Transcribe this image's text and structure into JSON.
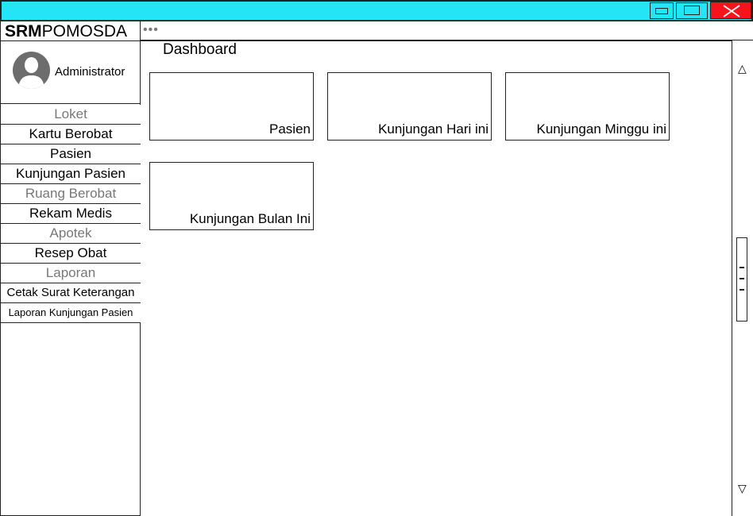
{
  "window": {
    "buttons": {
      "minimize_icon": "minimize-icon",
      "maximize_icon": "maximize-icon",
      "close_icon": "close-icon"
    }
  },
  "brand": {
    "bold": "SRM",
    "rest": "POMOSDA"
  },
  "toolbar": {
    "more": "•••"
  },
  "user": {
    "name": "Administrator",
    "avatar_icon": "user-avatar-icon"
  },
  "sidebar": {
    "items": [
      {
        "label": "Loket",
        "type": "header"
      },
      {
        "label": "Kartu Berobat",
        "type": "link"
      },
      {
        "label": "Pasien",
        "type": "link"
      },
      {
        "label": "Kunjungan Pasien",
        "type": "link"
      },
      {
        "label": "Ruang Berobat",
        "type": "header"
      },
      {
        "label": "Rekam Medis",
        "type": "link"
      },
      {
        "label": "Apotek",
        "type": "header"
      },
      {
        "label": "Resep Obat",
        "type": "link"
      },
      {
        "label": "Laporan",
        "type": "header"
      },
      {
        "label": "Cetak Surat Keterangan",
        "type": "link"
      },
      {
        "label": "Laporan Kunjungan Pasien",
        "type": "link"
      }
    ]
  },
  "main": {
    "title": "Dashboard",
    "cards": [
      {
        "label": "Pasien"
      },
      {
        "label": "Kunjungan Hari ini"
      },
      {
        "label": "Kunjungan Minggu ini"
      },
      {
        "label": "Kunjungan Bulan Ini"
      }
    ]
  },
  "scrollbar": {
    "up": "△",
    "down": "▽"
  },
  "colors": {
    "titlebar": "#24e5f5",
    "close": "#f5131c",
    "section_header_text": "#777777"
  }
}
